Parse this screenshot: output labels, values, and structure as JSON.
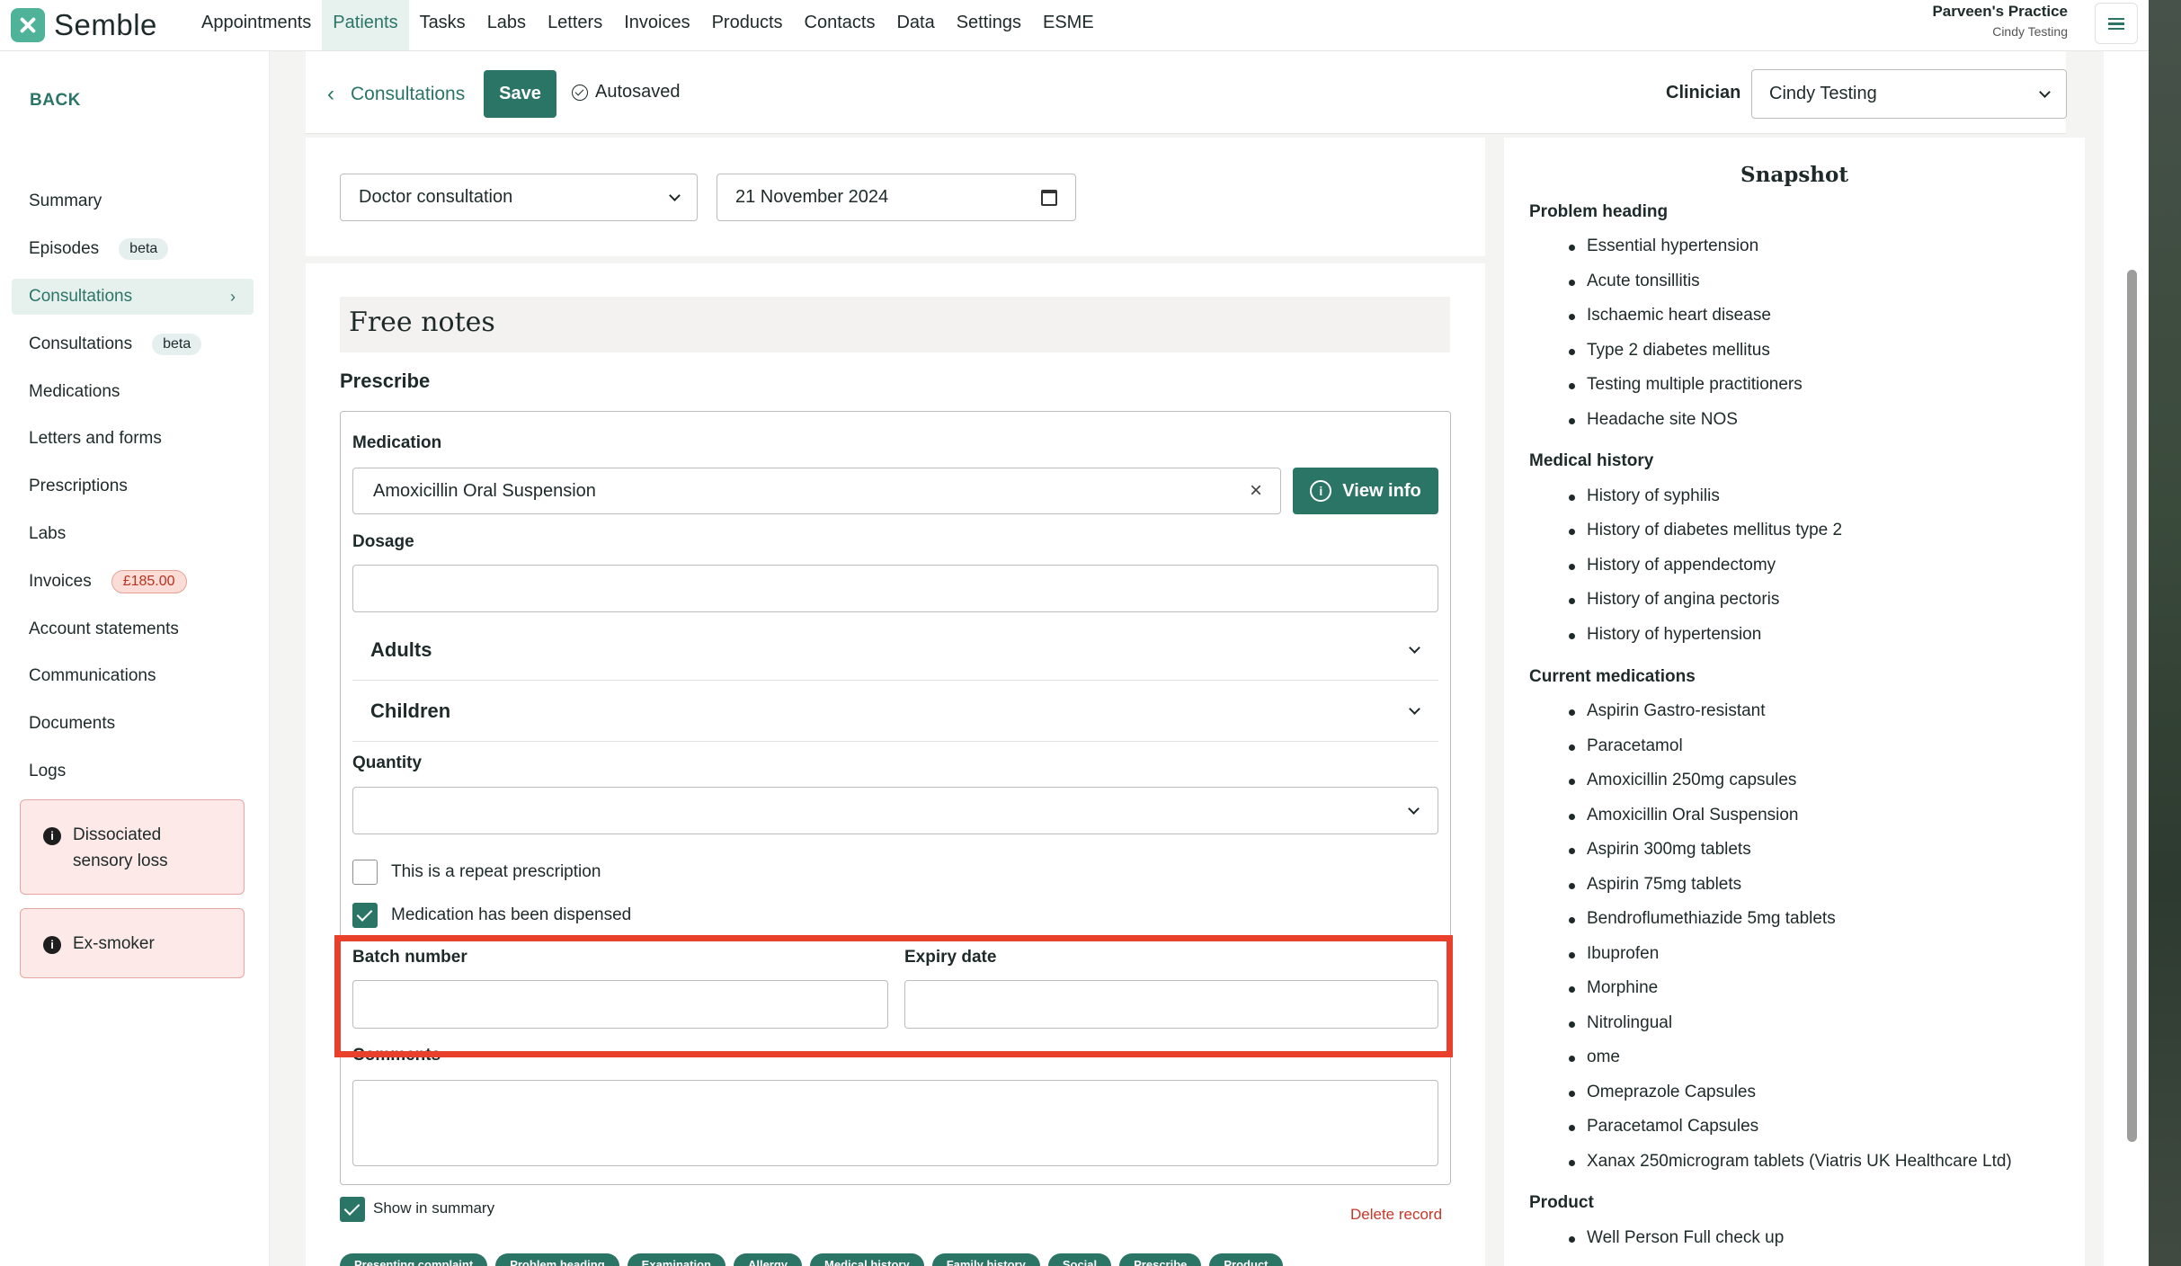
{
  "app": {
    "name": "Semble"
  },
  "nav": [
    "Appointments",
    "Patients",
    "Tasks",
    "Labs",
    "Letters",
    "Invoices",
    "Products",
    "Contacts",
    "Data",
    "Settings",
    "ESME"
  ],
  "practice": {
    "name": "Parveen's Practice",
    "user": "Cindy Testing"
  },
  "sidebar": {
    "back": "BACK",
    "items": [
      {
        "label": "Summary"
      },
      {
        "label": "Episodes",
        "badge": "beta"
      },
      {
        "label": "Consultations"
      },
      {
        "label": "Consultations",
        "badge": "beta"
      },
      {
        "label": "Medications"
      },
      {
        "label": "Letters and forms"
      },
      {
        "label": "Prescriptions"
      },
      {
        "label": "Labs"
      },
      {
        "label": "Invoices",
        "badge": "£185.00"
      },
      {
        "label": "Account statements"
      },
      {
        "label": "Communications"
      },
      {
        "label": "Documents"
      },
      {
        "label": "Logs"
      }
    ],
    "alerts": [
      "Dissociated sensory loss",
      "Ex-smoker"
    ]
  },
  "header": {
    "breadcrumb": "Consultations",
    "save": "Save",
    "autosaved": "Autosaved",
    "clinician_label": "Clinician",
    "clinician_value": "Cindy Testing"
  },
  "form": {
    "consultation_type": "Doctor consultation",
    "date": "21 November 2024",
    "free_notes": "Free notes",
    "prescribe": "Prescribe",
    "medication_label": "Medication",
    "medication_value": "Amoxicillin Oral Suspension",
    "view_info": "View info",
    "dosage_label": "Dosage",
    "adults": "Adults",
    "children": "Children",
    "quantity_label": "Quantity",
    "repeat_label": "This is a repeat prescription",
    "dispensed_label": "Medication has been dispensed",
    "batch_label": "Batch number",
    "expiry_label": "Expiry date",
    "comments_label": "Comments",
    "show_summary": "Show in summary",
    "delete_record": "Delete record",
    "chips": [
      "Presenting complaint",
      "Problem heading",
      "Examination",
      "Allergy",
      "Medical history",
      "Family history",
      "Social",
      "Prescribe",
      "Product"
    ]
  },
  "snapshot": {
    "title": "Snapshot",
    "sections": [
      {
        "heading": "Problem heading",
        "items": [
          "Essential hypertension",
          "Acute tonsillitis",
          "Ischaemic heart disease",
          "Type 2 diabetes mellitus",
          "Testing multiple practitioners",
          "Headache site NOS"
        ]
      },
      {
        "heading": "Medical history",
        "items": [
          "History of syphilis",
          "History of diabetes mellitus type 2",
          "History of appendectomy",
          "History of angina pectoris",
          "History of hypertension"
        ]
      },
      {
        "heading": "Current medications",
        "items": [
          "Aspirin Gastro-resistant",
          "Paracetamol",
          "Amoxicillin 250mg capsules",
          "Amoxicillin Oral Suspension",
          "Aspirin 300mg tablets",
          "Aspirin 75mg tablets",
          "Bendroflumethiazide 5mg tablets",
          "Ibuprofen",
          "Morphine",
          "Nitrolingual",
          "ome",
          "Omeprazole Capsules",
          "Paracetamol Capsules",
          "Xanax 250microgram tablets (Viatris UK Healthcare Ltd)"
        ]
      },
      {
        "heading": "Product",
        "items": [
          "Well Person Full check up"
        ]
      }
    ]
  },
  "colors": {
    "accent": "#2b7567",
    "highlight": "#e8402b",
    "danger": "#c6382a"
  }
}
